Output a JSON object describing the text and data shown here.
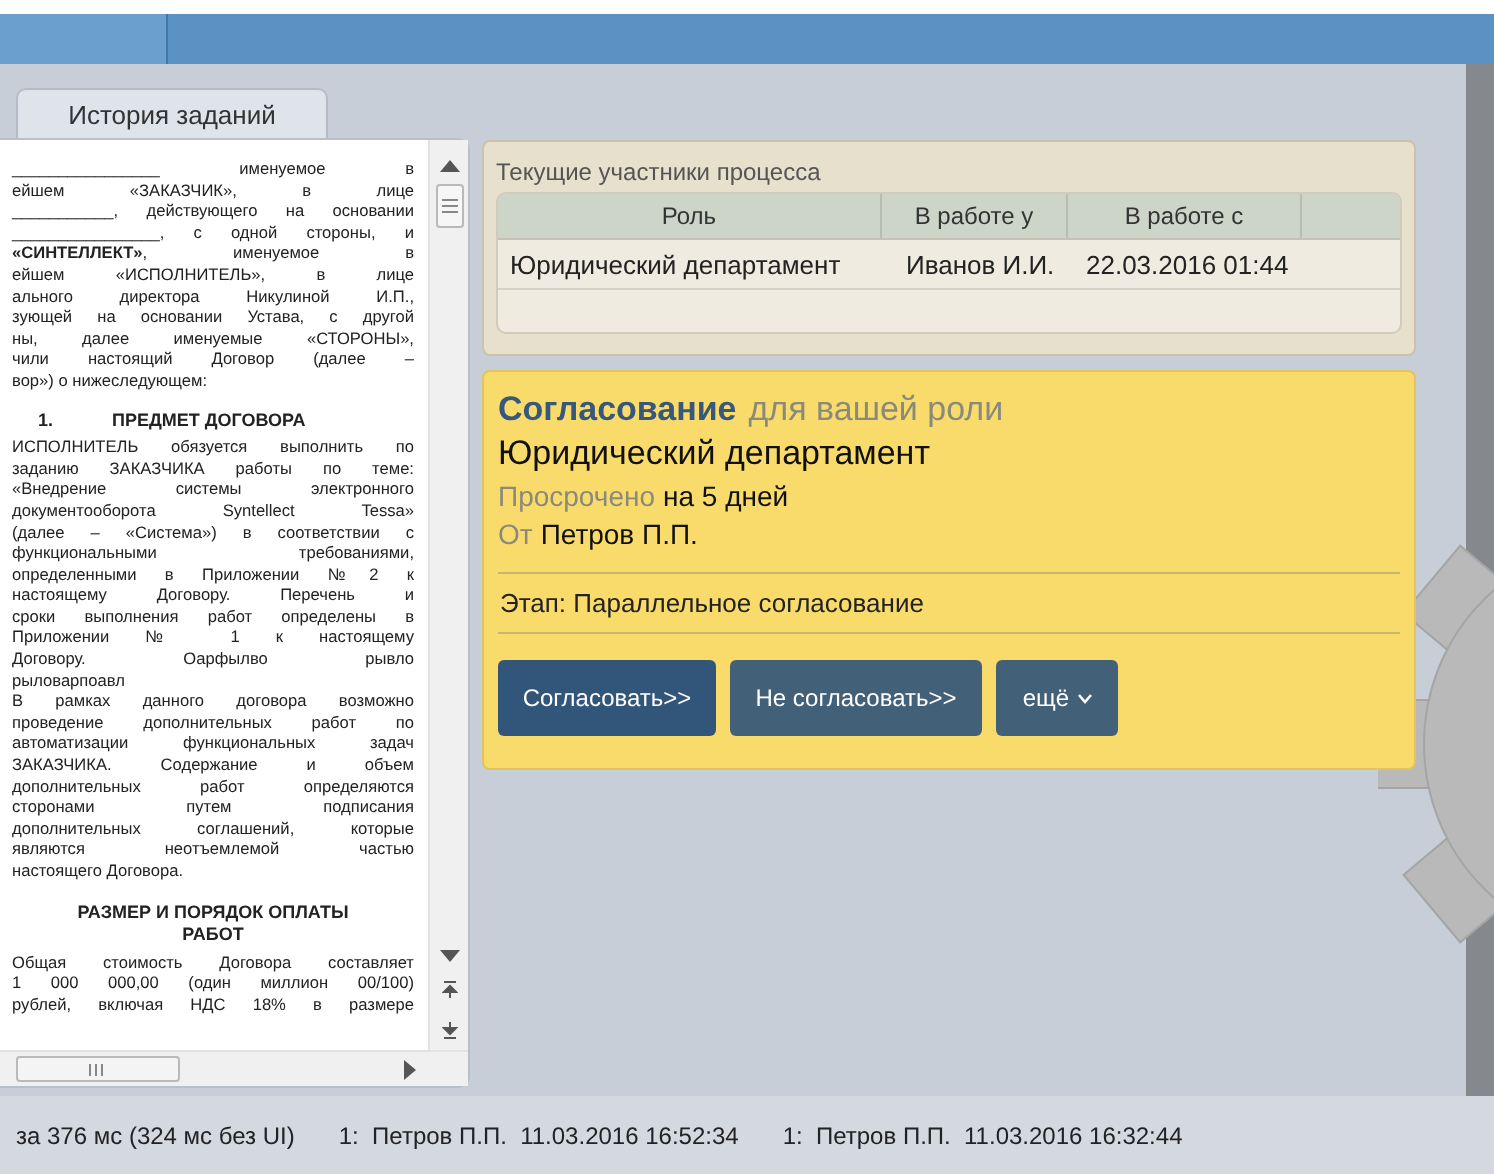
{
  "tabs": [
    {
      "label": "История заданий",
      "selected": true
    }
  ],
  "document": {
    "blocks": [
      {
        "kind": "line",
        "text": "________________ именуемое в"
      },
      {
        "kind": "line",
        "text": "ейшем «ЗАКАЗЧИК», в лице"
      },
      {
        "kind": "line",
        "text": "___________, действующего на основании"
      },
      {
        "kind": "line",
        "text": "________________, с одной стороны, и"
      },
      {
        "kind": "line",
        "text": "**«СИНТЕЛЛЕКТ»**, именуемое в"
      },
      {
        "kind": "line",
        "text": "ейшем «ИСПОЛНИТЕЛЬ», в лице"
      },
      {
        "kind": "line",
        "text": "ального директора Никулиной И.П.,"
      },
      {
        "kind": "line",
        "text": "зующей на основании Устава, с другой"
      },
      {
        "kind": "line",
        "text": "ны, далее именуемые «СТОРОНЫ»,"
      },
      {
        "kind": "line",
        "text": "чили настоящий Договор (далее –"
      },
      {
        "kind": "last",
        "text": "вор») о нижеследующем:"
      },
      {
        "kind": "heading",
        "number": "1.",
        "text": "ПРЕДМЕТ ДОГОВОРА"
      },
      {
        "kind": "line",
        "text": "ИСПОЛНИТЕЛЬ обязуется выполнить по"
      },
      {
        "kind": "line",
        "text": "заданию ЗАКАЗЧИКА работы по теме:"
      },
      {
        "kind": "line",
        "text": "«Внедрение системы электронного"
      },
      {
        "kind": "line",
        "text": "документооборота Syntellect Tessa»"
      },
      {
        "kind": "line",
        "text": "(далее – «Система») в соответствии с"
      },
      {
        "kind": "line",
        "text": "функциональными требованиями,"
      },
      {
        "kind": "line",
        "text": "определенными в Приложении №2 к"
      },
      {
        "kind": "line",
        "text": "настоящему Договору. Перечень и"
      },
      {
        "kind": "line",
        "text": "сроки выполнения работ определены в"
      },
      {
        "kind": "line",
        "text": "Приложении № 1 к настоящему"
      },
      {
        "kind": "line",
        "text": "Договору. Оарфылво рывло"
      },
      {
        "kind": "last",
        "text": "рыловарпоавл"
      },
      {
        "kind": "line",
        "text": "В рамках данного договора возможно"
      },
      {
        "kind": "line",
        "text": "проведение дополнительных работ по"
      },
      {
        "kind": "line",
        "text": "автоматизации функциональных задач"
      },
      {
        "kind": "line",
        "text": "ЗАКАЗЧИКА. Содержание и объем"
      },
      {
        "kind": "line",
        "text": "дополнительных работ определяются"
      },
      {
        "kind": "line",
        "text": "сторонами путем подписания"
      },
      {
        "kind": "line",
        "text": "дополнительных соглашений, которые"
      },
      {
        "kind": "line",
        "text": "являются неотъемлемой частью"
      },
      {
        "kind": "last",
        "text": "настоящего Договора."
      },
      {
        "kind": "center_heading",
        "text": "РАЗМЕР И ПОРЯДОК ОПЛАТЫ РАБОТ"
      },
      {
        "kind": "line",
        "text": "Общая стоимость Договора составляет"
      },
      {
        "kind": "line",
        "text": "1 000 000,00 (один миллион 00/100)"
      },
      {
        "kind": "line",
        "text": "рублей, включая НДС 18% в размере"
      }
    ]
  },
  "participants": {
    "title": "Текущие участники процесса",
    "columns": [
      "Роль",
      "В работе у",
      "В работе с"
    ],
    "rows": [
      [
        "Юридический департамент",
        "Иванов И.И.",
        "22.03.2016 01:44"
      ]
    ]
  },
  "task": {
    "type": "Согласование",
    "type_note": "для вашей роли",
    "role": "Юридический департамент",
    "overdue_label": "Просрочено",
    "overdue_value": "на 5 дней",
    "from_label": "От",
    "from_value": "Петров П.П.",
    "stage": "Этап: Параллельное согласование",
    "buttons": [
      {
        "label": "Согласовать>>",
        "kind": "primary"
      },
      {
        "label": "Не согласовать>>",
        "kind": "secondary"
      },
      {
        "label": "ещё",
        "kind": "menu"
      }
    ]
  },
  "status_bar": [
    "за 376 мс (324 мс без UI)",
    "1:  Петров П.П.  11.03.2016 16:52:34",
    "1:  Петров П.П.  11.03.2016 16:32:44"
  ]
}
